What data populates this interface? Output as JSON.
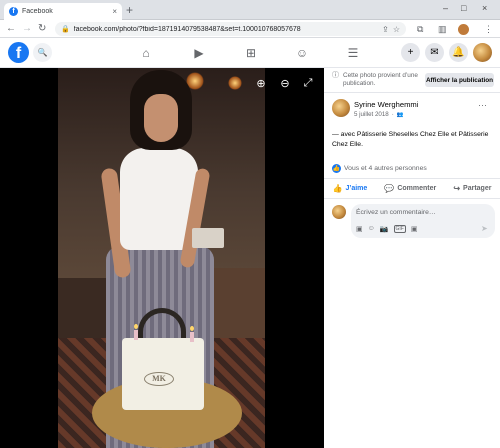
{
  "browser": {
    "tab_title": "Facebook",
    "tab_close": "×",
    "new_tab": "+",
    "url": "facebook.com/photo/?fbid=1871914079538487&set=t.100010768057678",
    "win_min": "–",
    "win_max": "□",
    "win_close": "×"
  },
  "icons": {
    "back": "←",
    "forward": "→",
    "reload": "↻",
    "lock": "🔒",
    "share": "⇪",
    "star": "☆",
    "extensions": "⧉",
    "sidebar": "▥",
    "menu_dots": "⋮",
    "search": "🔍",
    "home": "⌂",
    "video": "▶",
    "marketplace": "⊞",
    "groups": "☺",
    "hamburger": "☰",
    "plus": "+",
    "messenger": "✉",
    "bell": "🔔",
    "zoom_in": "⊕",
    "zoom_out": "⊖",
    "fullscreen": "⤢",
    "globe_info": "ⓘ",
    "friends": "👥",
    "like": "👍",
    "comment": "💬",
    "share_arrow": "↪",
    "emoji": "☺",
    "camera": "📷",
    "gif": "GIF",
    "sticker": "▣",
    "send": "➤",
    "ellipsis": "···"
  },
  "fb_logo_letter": "f",
  "post": {
    "photo_notice": "Cette photo provient d’une publication.",
    "view_post_label": "Afficher la publication",
    "author_name": "Syrine Werghemmi",
    "date": "5 juillet 2018",
    "dot": "·",
    "caption": "— avec Pâtisserie Sheselles Chez Elle et Pâtisserie Chez Elle.",
    "reactions_text": "Vous et 4 autres personnes",
    "like_label": "J’aime",
    "comment_label": "Commenter",
    "share_label": "Partager",
    "comment_placeholder": "Écrivez un commentaire…",
    "cake_logo": "MK"
  },
  "colors": {
    "brand_blue": "#1877f2",
    "viewer_bg": "#000000",
    "secondary_text": "#65676b"
  }
}
